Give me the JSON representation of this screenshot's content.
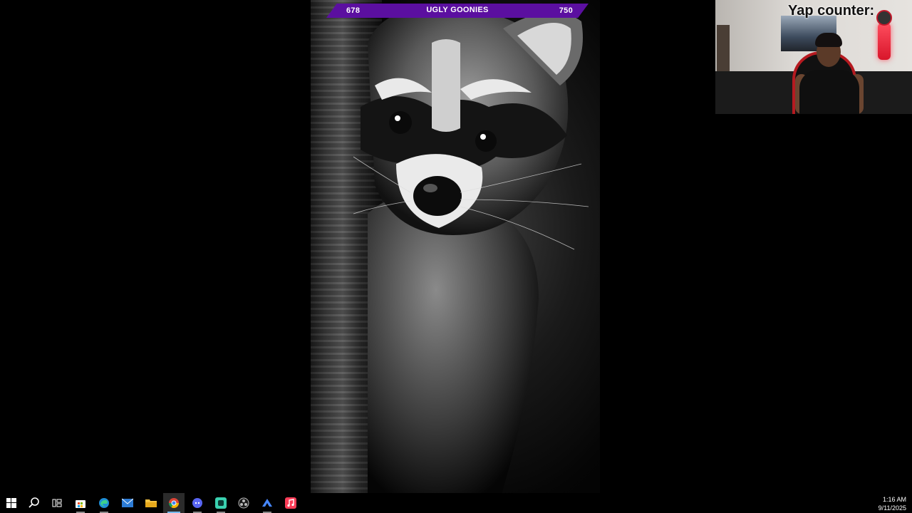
{
  "goal_bar": {
    "left_value": "678",
    "title": "UGLY GOONIES",
    "right_value": "750",
    "color": "#5b0fa0"
  },
  "overlay": {
    "yap_counter": "Yap counter: "
  },
  "taskbar": {
    "items": [
      {
        "name": "start-icon"
      },
      {
        "name": "search-icon"
      },
      {
        "name": "task-view-icon"
      },
      {
        "name": "store-icon"
      },
      {
        "name": "edge-icon"
      },
      {
        "name": "mail-icon"
      },
      {
        "name": "file-explorer-icon"
      },
      {
        "name": "chrome-icon"
      },
      {
        "name": "discord-icon"
      },
      {
        "name": "app-icon"
      },
      {
        "name": "obs-icon"
      },
      {
        "name": "vpn-icon"
      },
      {
        "name": "music-icon"
      }
    ],
    "clock": {
      "time": "1:16 AM",
      "date": "9/11/2025"
    }
  }
}
